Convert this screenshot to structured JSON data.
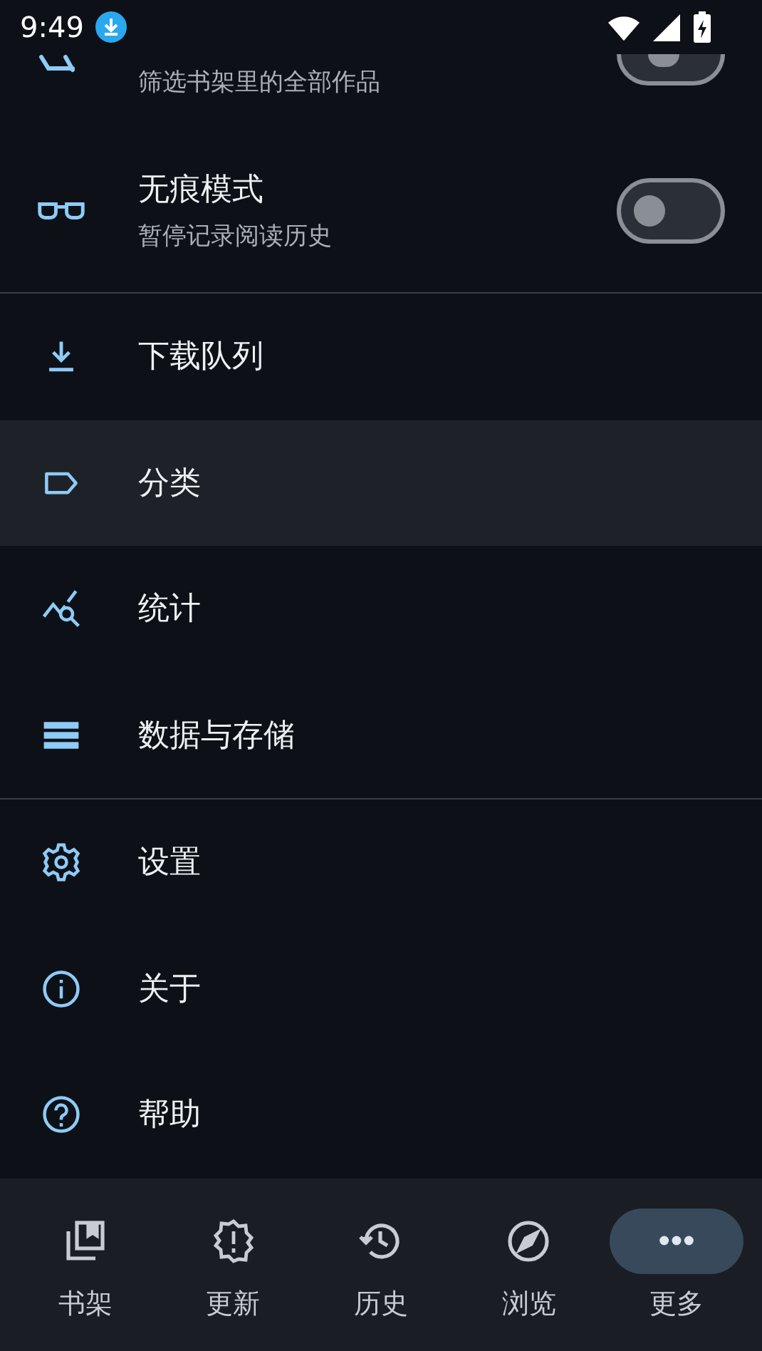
{
  "status_bar": {
    "time": "9:49"
  },
  "toggles": [
    {
      "subtitle": "筛选书架里的全部作品",
      "on": false,
      "kind": "partial"
    },
    {
      "title": "无痕模式",
      "subtitle": "暂停记录阅读历史",
      "on": false,
      "kind": "full"
    }
  ],
  "menu_groups": [
    [
      {
        "label": "下载队列",
        "selected": false
      },
      {
        "label": "分类",
        "selected": true
      },
      {
        "label": "统计",
        "selected": false
      },
      {
        "label": "数据与存储",
        "selected": false
      }
    ],
    [
      {
        "label": "设置",
        "selected": false
      },
      {
        "label": "关于",
        "selected": false
      },
      {
        "label": "帮助",
        "selected": false
      }
    ]
  ],
  "bottom_nav": [
    {
      "label": "书架",
      "selected": false
    },
    {
      "label": "更新",
      "selected": false
    },
    {
      "label": "历史",
      "selected": false
    },
    {
      "label": "浏览",
      "selected": false
    },
    {
      "label": "更多",
      "selected": true
    }
  ]
}
